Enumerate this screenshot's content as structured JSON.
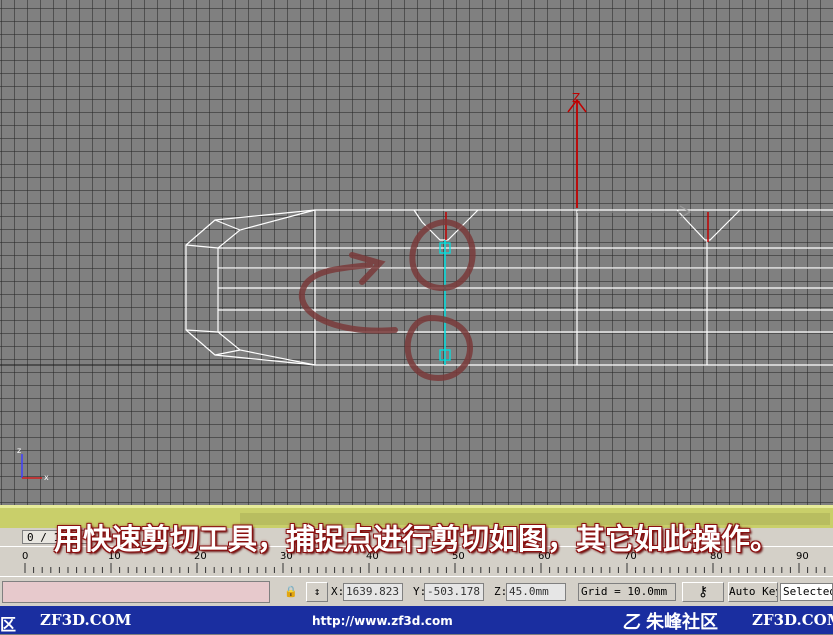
{
  "viewport": {
    "axis_tripod": {
      "x_label": "x",
      "z_label": "z"
    },
    "gizmo": {
      "z_label": "Z"
    }
  },
  "frame_counter": "0 / 100",
  "ruler": {
    "ticks": [
      "0",
      "10",
      "20",
      "30",
      "40",
      "50",
      "60",
      "70",
      "80",
      "90"
    ]
  },
  "status_bar": {
    "x_label": "X:",
    "x_value": "1639.823",
    "y_label": "Y:",
    "y_value": "-503.178",
    "z_label": "Z:",
    "z_value": "45.0mm",
    "grid": "Grid = 10.0mm",
    "auto_key": "Auto Key",
    "selection": "Selected"
  },
  "caption": "用快速剪切工具，捕捉点进行剪切如图，其它如此操作。",
  "watermark": {
    "left_char": "区",
    "site_left": "ZF3D.COM",
    "url": "http://www.zf3d.com",
    "brand": "朱峰社区",
    "site_right": "ZF3D.COM"
  },
  "colors": {
    "viewport_bg": "#808080",
    "wire": "#ffffff",
    "selected_edge": "#00d0d0",
    "annotation": "#7a3a3a",
    "gizmo": "#c00000"
  }
}
